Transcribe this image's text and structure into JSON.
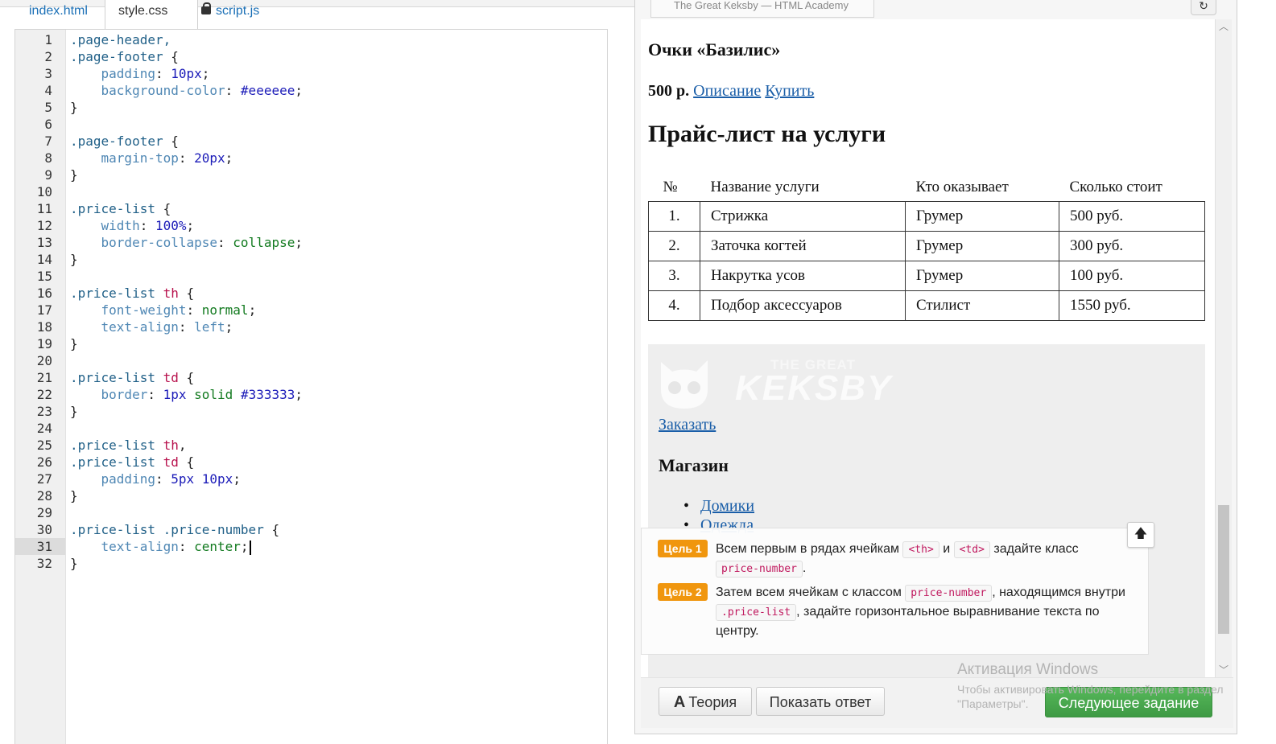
{
  "file_tabs": [
    {
      "label": "index.html"
    },
    {
      "label": "style.css"
    },
    {
      "label": "script.js"
    }
  ],
  "code_lines": [
    {
      "n": "1"
    },
    {
      "n": "2"
    },
    {
      "n": "3"
    },
    {
      "n": "4"
    },
    {
      "n": "5"
    },
    {
      "n": "6"
    },
    {
      "n": "7"
    },
    {
      "n": "8"
    },
    {
      "n": "9"
    },
    {
      "n": "10"
    },
    {
      "n": "11"
    },
    {
      "n": "12"
    },
    {
      "n": "13"
    },
    {
      "n": "14"
    },
    {
      "n": "15"
    },
    {
      "n": "16"
    },
    {
      "n": "17"
    },
    {
      "n": "18"
    },
    {
      "n": "19"
    },
    {
      "n": "20"
    },
    {
      "n": "21"
    },
    {
      "n": "22"
    },
    {
      "n": "23"
    },
    {
      "n": "24"
    },
    {
      "n": "25"
    },
    {
      "n": "26"
    },
    {
      "n": "27"
    },
    {
      "n": "28"
    },
    {
      "n": "29"
    },
    {
      "n": "30"
    },
    {
      "n": "31"
    },
    {
      "n": "32"
    }
  ],
  "code": {
    "l1": ".page-header,",
    "l2a": ".page-footer",
    "l2b": " {",
    "l3p": "padding",
    "l3v": "10px",
    "l4p": "background-color",
    "l4v": "#eeeeee",
    "l7a": ".page-footer",
    "l7b": " {",
    "l8p": "margin-top",
    "l8v": "20px",
    "l11a": ".price-list",
    "l11b": " {",
    "l12p": "width",
    "l12v": "100%",
    "l13p": "border-collapse",
    "l13v": "collapse",
    "l16a": ".price-list",
    "l16t": "th",
    "l16b": " {",
    "l17p": "font-weight",
    "l17v": "normal",
    "l18p": "text-align",
    "l18v": "left",
    "l21a": ".price-list",
    "l21t": "td",
    "l21b": " {",
    "l22p": "border",
    "l22n": "1px",
    "l22v": "solid",
    "l22c": "#333333",
    "l25a": ".price-list",
    "l25t": "th",
    "l25b": ",",
    "l26a": ".price-list",
    "l26t": "td",
    "l26b": " {",
    "l27p": "padding",
    "l27n1": "5px",
    "l27n2": "10px",
    "l30a": ".price-list .price-number",
    "l30b": " {",
    "l31p": "text-align",
    "l31v": "center",
    "close": "}"
  },
  "preview": {
    "tab_title": "The Great Keksby — HTML Academy",
    "reload_icon": "↻",
    "product_title": "Очки «Базилис»",
    "price": "500 р.",
    "link_description": "Описание",
    "link_buy": "Купить",
    "section_title": "Прайс-лист на услуги",
    "table": {
      "headers": [
        "№",
        "Название услуги",
        "Кто оказывает",
        "Сколько стоит"
      ],
      "rows": [
        [
          "1.",
          "Стрижка",
          "Грумер",
          "500 руб."
        ],
        [
          "2.",
          "Заточка когтей",
          "Грумер",
          "300 руб."
        ],
        [
          "3.",
          "Накрутка усов",
          "Грумер",
          "100 руб."
        ],
        [
          "4.",
          "Подбор аксессуаров",
          "Стилист",
          "1550 руб."
        ]
      ]
    },
    "logo_small": "THE GREAT",
    "logo_big": "KEKSBY",
    "order_link": "Заказать",
    "shop_title": "Магазин",
    "shop_items": [
      "Домики",
      "Одежда"
    ]
  },
  "tasks": {
    "goal1_badge": "Цель 1",
    "goal1_text_a": "Всем первым в рядах ячейкам ",
    "goal1_code1": "<th>",
    "goal1_text_b": " и ",
    "goal1_code2": "<td>",
    "goal1_text_c": " задайте класс ",
    "goal1_code3": "price-number",
    "goal1_text_d": ".",
    "goal2_badge": "Цель 2",
    "goal2_text_a": "Затем всем ячейкам с классом ",
    "goal2_code1": "price-number",
    "goal2_text_b": ", находящимся внутри ",
    "goal2_code2": ".price-list",
    "goal2_text_c": ", задайте горизонтальное выравнивание текста по центру.",
    "scroll_up_icon": "🡅"
  },
  "buttons": {
    "theory_icon": "A",
    "theory": "Теория",
    "show_answer": "Показать ответ",
    "next_task": "Следующее задание"
  },
  "watermark": {
    "line1": "Активация Windows",
    "line2": "Чтобы активировать Windows, перейдите в раздел \"Параметры\"."
  }
}
